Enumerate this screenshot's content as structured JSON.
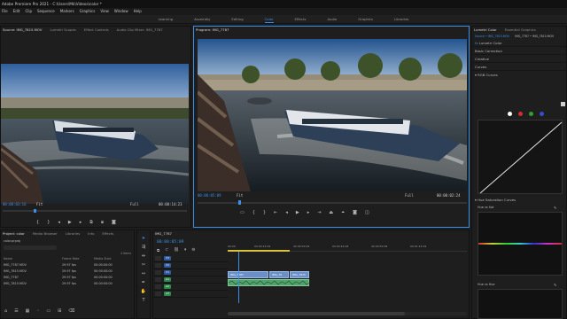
{
  "app": {
    "title": "Adobe Premiere Pro 2021 - C:\\Users\\Mk\\Videos\\color *"
  },
  "menu": [
    "File",
    "Edit",
    "Clip",
    "Sequence",
    "Markers",
    "Graphics",
    "View",
    "Window",
    "Help"
  ],
  "workspaces": {
    "items": [
      "Learning",
      "Assembly",
      "Editing",
      "Color",
      "Effects",
      "Audio",
      "Graphics",
      "Libraries"
    ],
    "active": "Color"
  },
  "source_monitor": {
    "tabs": [
      "Source: IMG_7815.MOV",
      "Lumetri Scopes",
      "Effect Controls",
      "Audio Clip Mixer: IMG_7787"
    ],
    "timecode": "00:00:03:16",
    "fit": "Fit",
    "full": "Full",
    "duration": "00:00:14:23"
  },
  "program_monitor": {
    "tab": "Program: IMG_7787",
    "timecode": "00:00:05:09",
    "fit": "Fit",
    "full": "Full",
    "duration": "00:00:02:24"
  },
  "lumetri": {
    "tabs": [
      "Lumetri Color",
      "Essential Graphics"
    ],
    "source_line": "Source • IMG_7815.MOV",
    "sequence_line": "IMG_7787 • IMG_7815.MOV",
    "lumetri_label": "Lumetri Color",
    "sections": [
      "Basic Correction",
      "Creative",
      "Curves"
    ],
    "rgb_curves": "RGB Curves",
    "hue_sat_curves": "Hue Saturation Curves",
    "hue_vs_sat": "Hue vs Sat",
    "hue_vs_hue": "Hue vs Hue",
    "channel_colors": [
      "#ffffff",
      "#d03030",
      "#30a030",
      "#3050d0"
    ]
  },
  "project": {
    "tabs": [
      "Project: color",
      "Media Browser",
      "Libraries",
      "Info",
      "Effects"
    ],
    "file": "color.prproj",
    "items_count": "4 items",
    "columns": [
      "Name",
      "Frame Rate",
      "Media Start"
    ],
    "rows": [
      {
        "name": "IMG_7787.MOV",
        "fps": "29.97 fps",
        "start": "00:00:00:00"
      },
      {
        "name": "IMG_7815.MOV",
        "fps": "29.97 fps",
        "start": "00:00:00:00"
      },
      {
        "name": "IMG_7787",
        "fps": "29.97 fps",
        "start": "00:00:00:00"
      },
      {
        "name": "IMG_7815.MOV",
        "fps": "29.97 fps",
        "start": "00:00:00:00"
      }
    ]
  },
  "timeline": {
    "tab": "IMG_7787",
    "timecode": "00:00:05:09",
    "ruler": [
      "00:00",
      "00:00:14:29",
      "00:00:29:29",
      "00:00:44:28",
      "00:00:59:28",
      "00:01:14:29"
    ],
    "tracks": [
      "V3",
      "V2",
      "V1",
      "A1",
      "A2",
      "A3"
    ],
    "clips": [
      "IMG_7787",
      "IMG_78",
      "IMG_7815"
    ]
  },
  "colors": {
    "accent": "#3b8fe6",
    "video_clip": "#6b8fc7",
    "audio_clip": "#4fa36b"
  }
}
